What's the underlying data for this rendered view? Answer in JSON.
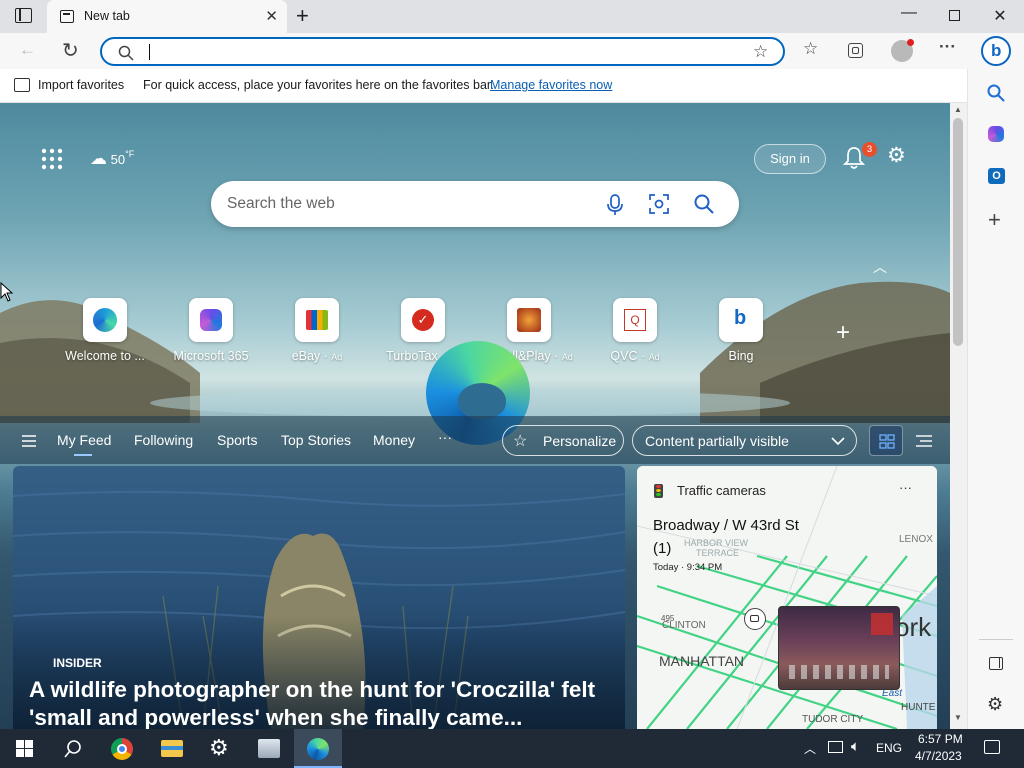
{
  "browser": {
    "tab_title": "New tab",
    "address_value": "",
    "favbar_import": "Import favorites",
    "favbar_message": "For quick access, place your favorites here on the favorites bar.",
    "favbar_manage": "Manage favorites now"
  },
  "newtab": {
    "weather_temp": "50",
    "weather_unit": "°F",
    "sign_in": "Sign in",
    "notification_count": "3",
    "search_placeholder": "Search the web",
    "quick_links": [
      {
        "label": "Welcome to ...",
        "ad": ""
      },
      {
        "label": "Microsoft 365",
        "ad": ""
      },
      {
        "label": "eBay",
        "ad": "Ad"
      },
      {
        "label": "TurboTax",
        "ad": "Ad"
      },
      {
        "label": "Install&Play",
        "ad": "Ad"
      },
      {
        "label": "QVC",
        "ad": "Ad"
      },
      {
        "label": "Bing",
        "ad": ""
      }
    ],
    "feed_tabs": [
      "My Feed",
      "Following",
      "Sports",
      "Top Stories",
      "Money"
    ],
    "more": "···",
    "personalize": "Personalize",
    "content_visibility": "Content partially visible",
    "main_story": {
      "source": "INSIDER",
      "headline": "A wildlife photographer on the hunt for 'Croczilla' felt 'small and powerless' when she finally came..."
    },
    "traffic_card": {
      "title": "Traffic cameras",
      "location": "Broadway / W 43rd St",
      "count": "(1)",
      "timestamp": "Today · 9:34 PM",
      "map_labels": [
        "HARBOR VIEW",
        "TERRACE",
        "CLINTON",
        "MANHATTAN",
        "TUDOR CITY",
        "LENOX",
        "HUNTE",
        "East",
        "ork",
        "495"
      ],
      "menu": "···"
    }
  },
  "taskbar": {
    "language": "ENG",
    "time": "6:57 PM",
    "date": "4/7/2023"
  },
  "colors": {
    "accent": "#0067c0",
    "taskbar": "#1f2a36",
    "notification_badge": "#e8502d"
  }
}
